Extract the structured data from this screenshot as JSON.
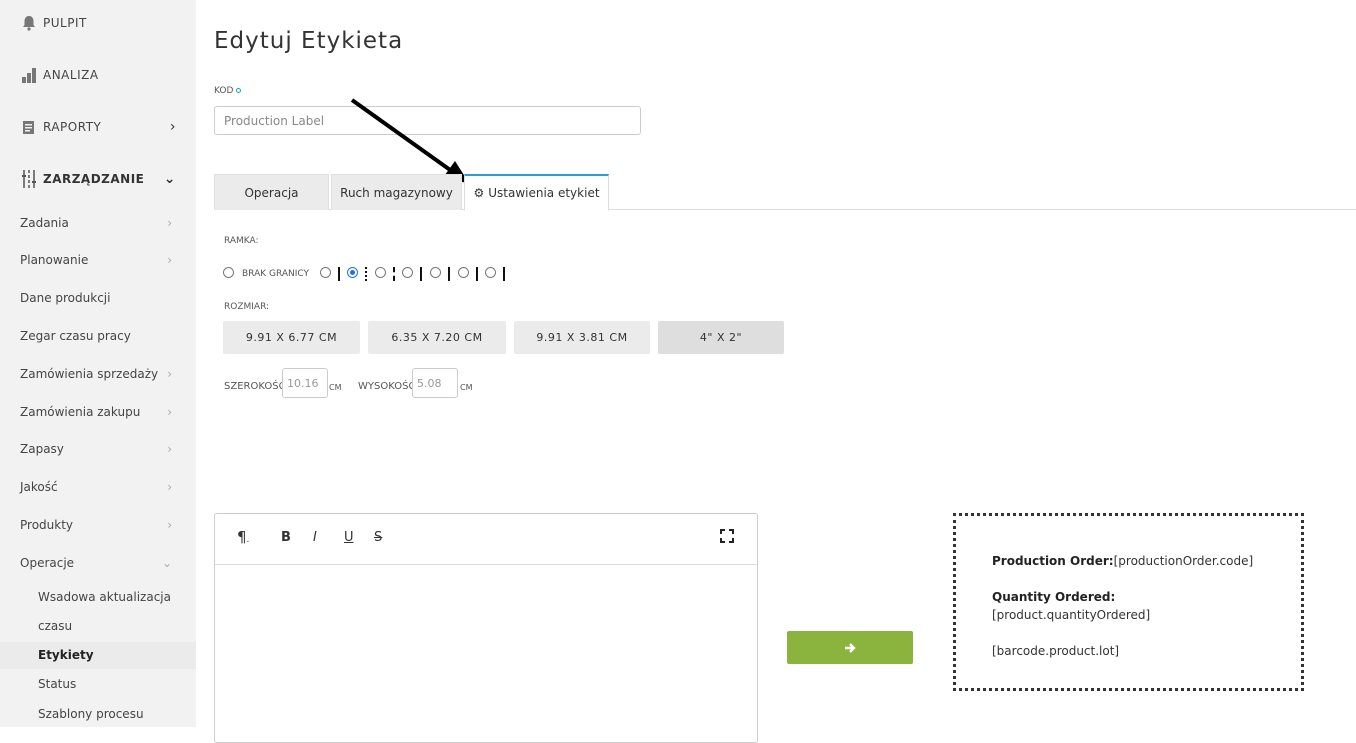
{
  "sidebar": {
    "top": [
      {
        "label": "PULPIT",
        "icon": "bell-icon"
      },
      {
        "label": "ANALIZA",
        "icon": "bar-chart-icon"
      },
      {
        "label": "RAPORTY",
        "icon": "report-icon"
      },
      {
        "label": "ZARZĄDZANIE",
        "icon": "sliders-icon"
      }
    ],
    "items": [
      "Zadania",
      "Planowanie",
      "Dane produkcji",
      "Zegar czasu pracy",
      "Zamówienia sprzedaży",
      "Zamówienia zakupu",
      "Zapasy",
      "Jakość",
      "Produkty",
      "Operacje"
    ],
    "sub": [
      "Wsadowa aktualizacja",
      "czasu",
      "Etykiety",
      "Status",
      "Szablony procesu"
    ]
  },
  "page": {
    "title": "Edytuj Etykieta",
    "kod_label": "KOD",
    "kod_value": "Production Label"
  },
  "tabs": [
    "Operacja",
    "Ruch magazynowy",
    "Ustawienia etykiet"
  ],
  "ramka": {
    "label": "RAMKA:",
    "no_border": "BRAK GRANICY",
    "selected_index": 1
  },
  "rozmiar": {
    "label": "ROZMIAR:",
    "options": [
      "9.91 X 6.77 CM",
      "6.35 X 7.20 CM",
      "9.91 X 3.81 CM",
      "4\" X 2\""
    ],
    "selected_index": 3
  },
  "dimensions": {
    "width_label": "SZEROKOŚĆ",
    "width_value": "10.16",
    "height_label": "WYSOKOŚĆ",
    "height_value": "5.08",
    "unit": "CM"
  },
  "editor": {
    "tools": [
      "paragraph-icon",
      "bold-icon",
      "italic-icon",
      "underline-icon",
      "strikethrough-icon",
      "fullscreen-icon"
    ]
  },
  "preview": {
    "order_label": "Production Order:",
    "order_value": "[productionOrder.code]",
    "qty_label": "Quantity Ordered:",
    "qty_value": "[product.quantityOrdered]",
    "barcode": "[barcode.product.lot]"
  },
  "colors": {
    "accent": "#2a9fd6",
    "go_button": "#8ab43e",
    "radio": "#1a73e8"
  }
}
